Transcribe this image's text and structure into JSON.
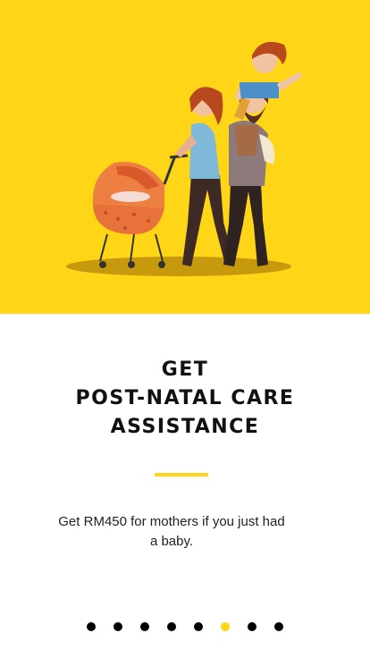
{
  "hero": {
    "illustration_name": "family-with-stroller-illustration",
    "background_color": "#FFD517"
  },
  "title": {
    "line1": "GET",
    "line2": "POST-NATAL CARE",
    "line3": "ASSISTANCE"
  },
  "description": "Get RM450 for mothers if you just had a baby.",
  "pager": {
    "total": 8,
    "active_index": 5,
    "active_color": "#FFD517",
    "inactive_color": "#000000"
  }
}
